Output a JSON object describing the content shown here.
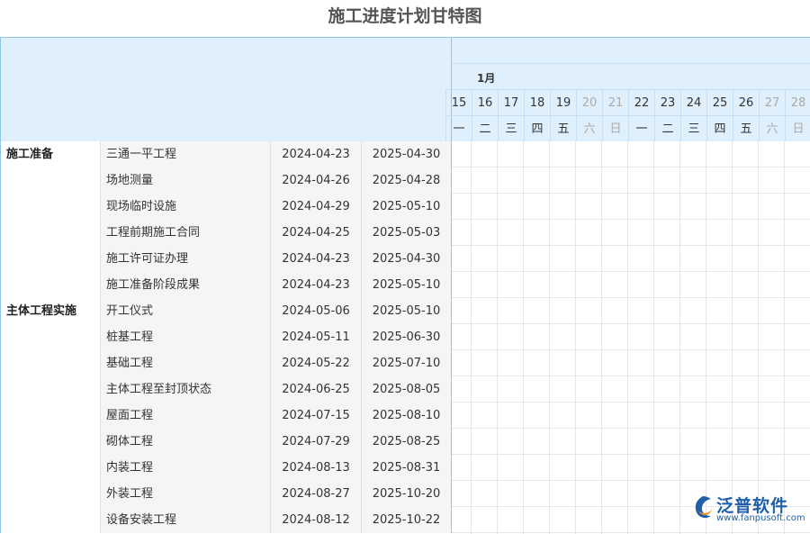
{
  "title": "施工进度计划甘特图",
  "timeline": {
    "month": "1月",
    "days": [
      {
        "d": "15",
        "w": "一",
        "weekend": false
      },
      {
        "d": "16",
        "w": "二",
        "weekend": false
      },
      {
        "d": "17",
        "w": "三",
        "weekend": false
      },
      {
        "d": "18",
        "w": "四",
        "weekend": false
      },
      {
        "d": "19",
        "w": "五",
        "weekend": false
      },
      {
        "d": "20",
        "w": "六",
        "weekend": true
      },
      {
        "d": "21",
        "w": "日",
        "weekend": true
      },
      {
        "d": "22",
        "w": "一",
        "weekend": false
      },
      {
        "d": "23",
        "w": "二",
        "weekend": false
      },
      {
        "d": "24",
        "w": "三",
        "weekend": false
      },
      {
        "d": "25",
        "w": "四",
        "weekend": false
      },
      {
        "d": "26",
        "w": "五",
        "weekend": false
      },
      {
        "d": "27",
        "w": "六",
        "weekend": true
      },
      {
        "d": "28",
        "w": "日",
        "weekend": true
      }
    ]
  },
  "rows": [
    {
      "group": "施工准备",
      "task": "三通一平工程",
      "start": "2024-04-23",
      "end": "2025-04-30"
    },
    {
      "group": "",
      "task": "场地测量",
      "start": "2024-04-26",
      "end": "2025-04-28"
    },
    {
      "group": "",
      "task": "现场临时设施",
      "start": "2024-04-29",
      "end": "2025-05-10"
    },
    {
      "group": "",
      "task": "工程前期施工合同",
      "start": "2024-04-25",
      "end": "2025-05-03"
    },
    {
      "group": "",
      "task": "施工许可证办理",
      "start": "2024-04-23",
      "end": "2025-04-30"
    },
    {
      "group": "",
      "task": "施工准备阶段成果",
      "start": "2024-04-23",
      "end": "2025-05-10"
    },
    {
      "group": "主体工程实施",
      "task": "开工仪式",
      "start": "2024-05-06",
      "end": "2025-05-10"
    },
    {
      "group": "",
      "task": "桩基工程",
      "start": "2024-05-11",
      "end": "2025-06-30"
    },
    {
      "group": "",
      "task": "基础工程",
      "start": "2024-05-22",
      "end": "2025-07-10"
    },
    {
      "group": "",
      "task": "主体工程至封顶状态",
      "start": "2024-06-25",
      "end": "2025-08-05"
    },
    {
      "group": "",
      "task": "屋面工程",
      "start": "2024-07-15",
      "end": "2025-08-10"
    },
    {
      "group": "",
      "task": "砌体工程",
      "start": "2024-07-29",
      "end": "2025-08-25"
    },
    {
      "group": "",
      "task": "内装工程",
      "start": "2024-08-13",
      "end": "2025-08-31"
    },
    {
      "group": "",
      "task": "外装工程",
      "start": "2024-08-27",
      "end": "2025-10-20"
    },
    {
      "group": "",
      "task": "设备安装工程",
      "start": "2024-08-12",
      "end": "2025-10-22"
    }
  ],
  "watermark": {
    "name": "泛普软件",
    "url": "www.fanpusoft.com",
    "icon": "fanpu-logo-icon"
  }
}
